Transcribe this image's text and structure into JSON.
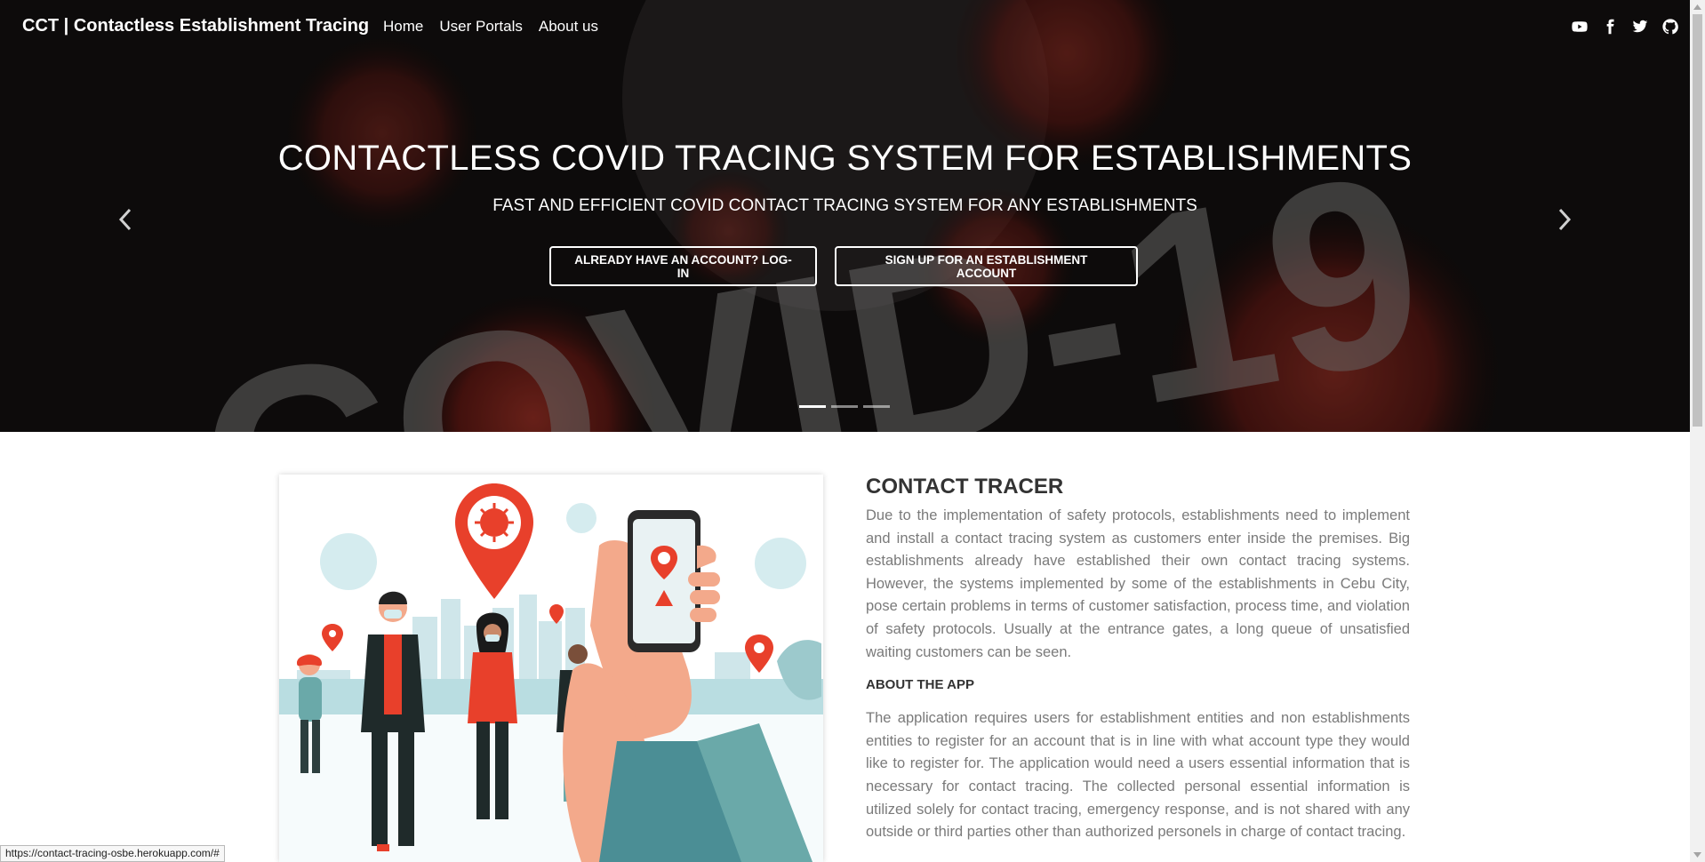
{
  "navbar": {
    "brand": "CCT | Contactless Establishment Tracing",
    "links": [
      "Home",
      "User Portals",
      "About us"
    ],
    "socials": [
      "youtube-icon",
      "facebook-icon",
      "twitter-icon",
      "github-icon"
    ]
  },
  "hero": {
    "background_text": "COVID-19",
    "title": "CONTACTLESS COVID TRACING SYSTEM FOR ESTABLISHMENTS",
    "subtitle": "FAST AND EFFICIENT COVID CONTACT TRACING SYSTEM FOR ANY ESTABLISHMENTS",
    "login_button": "ALREADY HAVE AN ACCOUNT? LOG-IN",
    "signup_button": "SIGN UP FOR AN ESTABLISHMENT ACCOUNT",
    "slides_total": 3,
    "active_slide": 1
  },
  "article": {
    "title": "CONTACT TRACER",
    "paragraph1": "Due to the implementation of safety protocols, establishments need to implement and install a contact tracing system as customers enter inside the premises. Big establishments already have established their own contact tracing systems. However, the systems implemented by some of the establishments in Cebu City, pose certain problems in terms of customer satisfaction, process time, and violation of safety protocols. Usually at the entrance gates, a long queue of unsatisfied waiting customers can be seen.",
    "subheading": "ABOUT THE APP",
    "paragraph2": "The application requires users for establishment entities and non establishments entities to register for an account that is in line with what account type they would like to register for. The application would need a users essential information that is necessary for contact tracing. The collected personal essential information is utilized solely for contact tracing, emergency response, and is not shared with any outside or third parties other than authorized personels in charge of contact tracing."
  },
  "status_bar": {
    "url": "https://contact-tracing-osbe.herokuapp.com/#"
  },
  "colors": {
    "accent_red": "#e8402b",
    "teal": "#6aa9a9",
    "skin": "#f3a98b"
  }
}
